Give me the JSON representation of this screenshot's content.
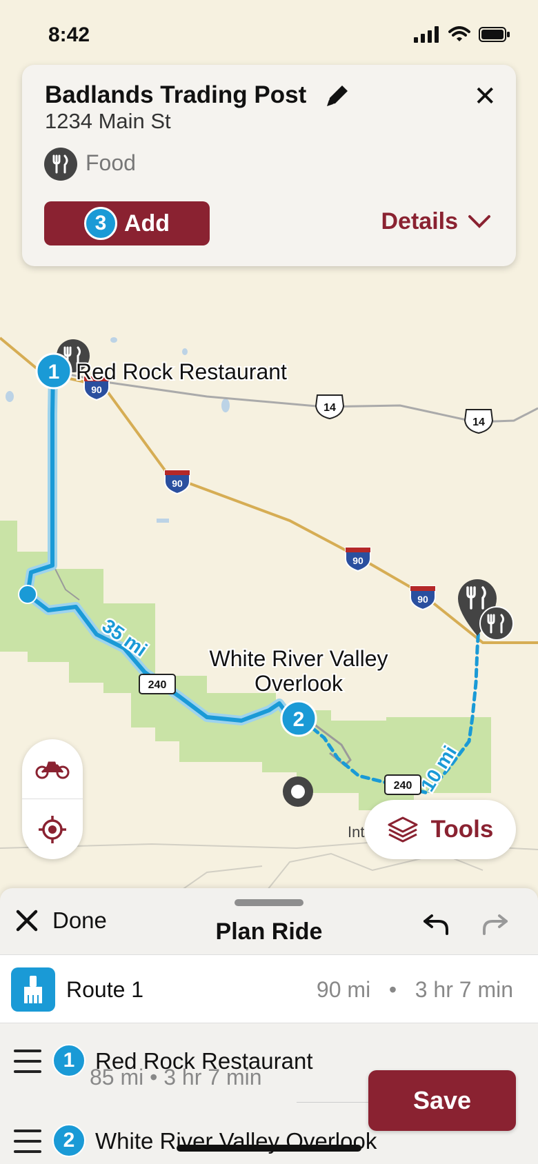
{
  "status_bar": {
    "time": "8:42"
  },
  "poi_card": {
    "title": "Badlands Trading Post",
    "address": "1234 Main St",
    "category": "Food",
    "add_button": {
      "number": "3",
      "label": "Add"
    },
    "details_label": "Details"
  },
  "map": {
    "labels": {
      "waypoint_1": "Red Rock Restaurant",
      "waypoint_2_line1": "White River Valley",
      "waypoint_2_line2": "Overlook",
      "segment_1_distance": "35 mi",
      "segment_2_distance": "10 mi",
      "partial_place": "Int"
    },
    "shields": {
      "i90": "90",
      "us14": "14",
      "sr240": "240"
    },
    "waypoint_numbers": [
      "1",
      "2"
    ]
  },
  "tools_button": {
    "label": "Tools"
  },
  "sheet": {
    "done_label": "Done",
    "title": "Plan Ride",
    "route": {
      "name": "Route 1",
      "distance": "90 mi",
      "separator": "•",
      "duration": "3 hr 7 min"
    },
    "stops": [
      {
        "number": "1",
        "name": "Red Rock Restaurant"
      },
      {
        "number": "2",
        "name": "White River Valley Overlook"
      }
    ],
    "leg_summary": "85 mi • 3 hr 7 min",
    "save_label": "Save"
  },
  "colors": {
    "brand": "#8a2231",
    "route": "#1a9ad6",
    "park": "#c9e3a6",
    "highway": "#d6ad54"
  },
  "icons": [
    "signal-icon",
    "wifi-icon",
    "battery-icon",
    "pencil-icon",
    "close-icon",
    "food-icon",
    "chevron-down-icon",
    "motorcycle-icon",
    "locate-icon",
    "layers-icon",
    "undo-icon",
    "redo-icon",
    "paint-brush-icon",
    "drag-handle-icon"
  ]
}
